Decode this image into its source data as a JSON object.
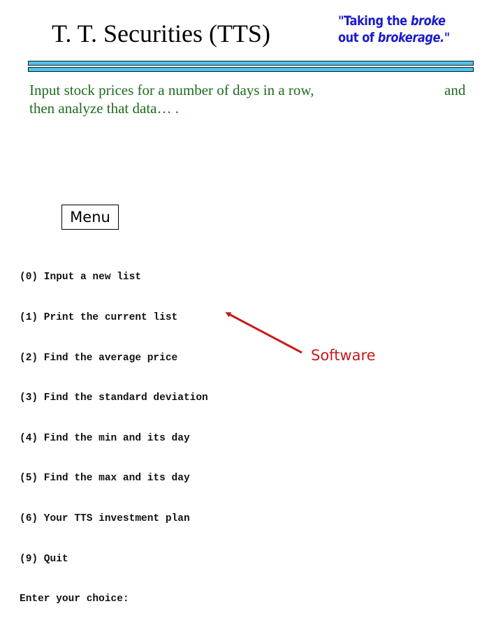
{
  "header": {
    "title": "T. T. Securities (TTS)",
    "slogan": {
      "line1_prefix": "\"Taking the ",
      "line1_emphasis": "broke",
      "line2_prefix": "out of ",
      "line2_emphasis": "brokerage.",
      "line2_suffix": "\""
    }
  },
  "colors": {
    "slogan": "#1a1ad0",
    "rule_fill": "#4cc4ec",
    "intro_text": "#1e6b1e",
    "annotation": "#c81a1a"
  },
  "intro": {
    "lines": [
      "Input stock prices for a number of days in a row,",
      "then analyze that data… ."
    ],
    "trailing_word": "and"
  },
  "menu": {
    "label": "Menu"
  },
  "console": {
    "options": [
      "(0) Input a new list",
      "(1) Print the current list",
      "(2) Find the average price",
      "(3) Find the standard deviation",
      "(4) Find the min and its day",
      "(5) Find the max and its day",
      "(6) Your TTS investment plan",
      "(9) Quit"
    ],
    "prompt": "Enter your choice:"
  },
  "annotation": {
    "label": "Software",
    "icon": "arrow-icon"
  }
}
